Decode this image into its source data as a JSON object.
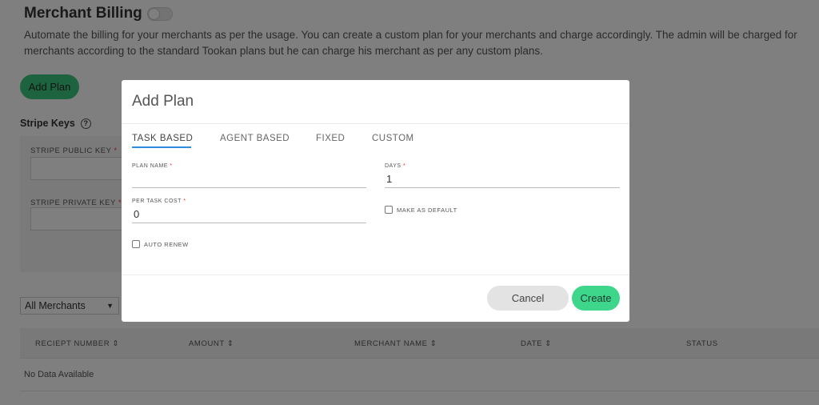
{
  "page": {
    "title": "Merchant Billing",
    "description": "Automate the billing for your merchants as per the usage. You can create a custom plan for your merchants and charge accordingly. The admin will be charged for merchants according to the standard Tookan plans but he can charge his merchant as per any custom plans.",
    "add_plan_label": "Add Plan",
    "stripe_keys_title": "Stripe Keys",
    "stripe_public_key_label": "STRIPE PUBLIC KEY",
    "stripe_private_key_label": "STRIPE PRIVATE KEY",
    "required_mark": "*",
    "help_icon_glyph": "?",
    "merchant_filter": "All Merchants",
    "table": {
      "columns": [
        "RECIEPT NUMBER ⇕",
        "AMOUNT ⇕",
        "MERCHANT NAME ⇕",
        "DATE ⇕",
        "STATUS"
      ],
      "empty_text": "No Data Available"
    }
  },
  "modal": {
    "title": "Add Plan",
    "tabs": [
      "TASK BASED",
      "AGENT BASED",
      "FIXED",
      "CUSTOM"
    ],
    "active_tab": "TASK BASED",
    "plan_name_label": "PLAN NAME",
    "plan_name_value": "",
    "days_label": "DAYS",
    "days_value": "1",
    "per_task_cost_label": "PER TASK COST",
    "per_task_cost_value": "0",
    "make_default_label": "MAKE AS DEFAULT",
    "auto_renew_label": "AUTO RENEW",
    "cancel_label": "Cancel",
    "create_label": "Create"
  },
  "colors": {
    "accent_green": "#3ed68b",
    "tab_underline": "#2f8fde",
    "required": "#ee3333"
  }
}
